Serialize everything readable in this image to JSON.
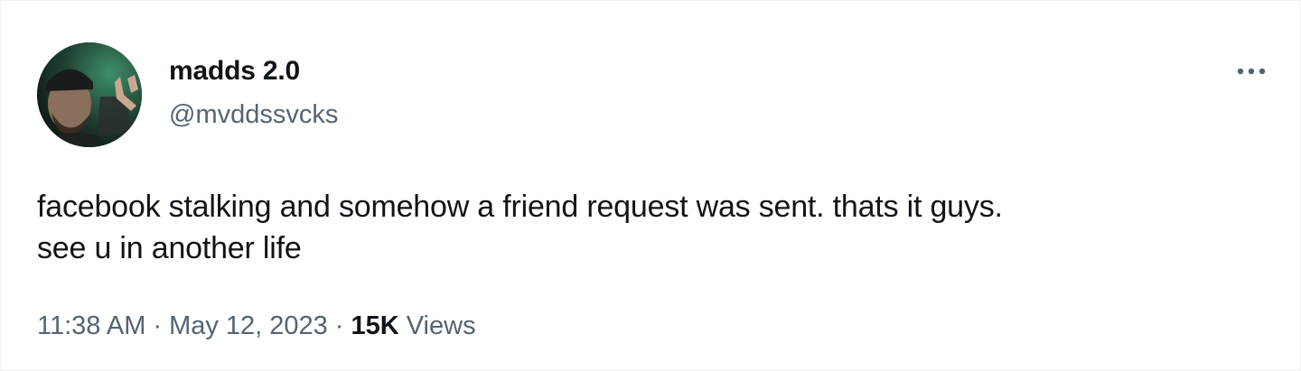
{
  "author": {
    "display_name": "madds 2.0",
    "handle": "@mvddssvcks",
    "avatar_icon": "user-avatar-photo"
  },
  "more_icon": "more-horizontal-icon",
  "tweet": {
    "text": "facebook stalking and somehow a friend request was sent. thats it guys.\nsee u in another life"
  },
  "meta": {
    "time": "11:38 AM",
    "separator": "·",
    "date": "May 12, 2023",
    "views_count": "15K",
    "views_label": "Views"
  },
  "colors": {
    "primary_text": "#0f1419",
    "secondary_text": "#536471",
    "background": "#ffffff"
  }
}
